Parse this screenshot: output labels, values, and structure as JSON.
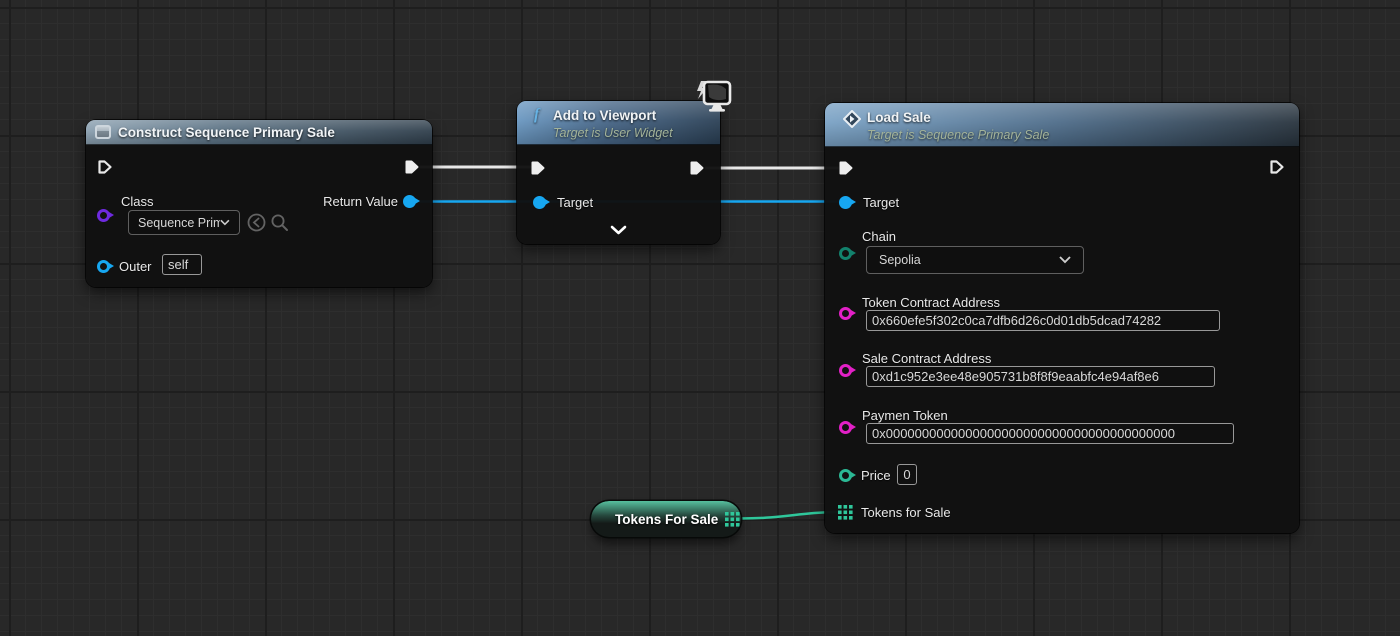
{
  "graph_type": "unreal-blueprint-graph",
  "colors": {
    "exec_wire": "#e8e8e8",
    "object_pin": "#17a7f1",
    "class_pin": "#6f2ae0",
    "string_pin": "#e220c6",
    "enum_pin": "#10705e",
    "int_pin": "#2bb894",
    "array_pin": "#2fc79b",
    "header_construct": "#5a7183",
    "header_function": "#476687"
  },
  "icons": {
    "construct_node": "window-box-icon",
    "viewport_node": "function-f-icon",
    "loadsale_node": "diamond-arrow-icon",
    "viewport_corner": "monitor-lightning-icon",
    "array": "grid-3x3-icon",
    "use_selected": "circle-back-arrow-icon",
    "browse": "magnifier-icon",
    "dropdown": "chevron-down-icon",
    "collapse": "chevron-down-icon"
  },
  "nodes": {
    "construct": {
      "title": "Construct Sequence Primary Sale",
      "class_label": "Class",
      "class_value": "Sequence Prima",
      "return_label": "Return Value",
      "outer_label": "Outer",
      "outer_value": "self"
    },
    "viewport": {
      "title": "Add to Viewport",
      "subtitle": "Target is User Widget",
      "target_label": "Target"
    },
    "loadsale": {
      "title": "Load Sale",
      "subtitle": "Target is Sequence Primary Sale",
      "target_label": "Target",
      "chain_label": "Chain",
      "chain_value": "Sepolia",
      "token_contract_label": "Token Contract Address",
      "token_contract_value": "0x660efe5f302c0ca7dfb6d26c0d01db5dcad74282",
      "sale_contract_label": "Sale Contract Address",
      "sale_contract_value": "0xd1c952e3ee48e905731b8f8f9eaabfc4e94af8e6",
      "payment_token_label": "Paymen Token",
      "payment_token_value": "0x0000000000000000000000000000000000000000",
      "price_label": "Price",
      "price_value": "0",
      "tokens_for_sale_label": "Tokens for Sale"
    },
    "tokens_var": {
      "title": "Tokens For Sale"
    }
  }
}
